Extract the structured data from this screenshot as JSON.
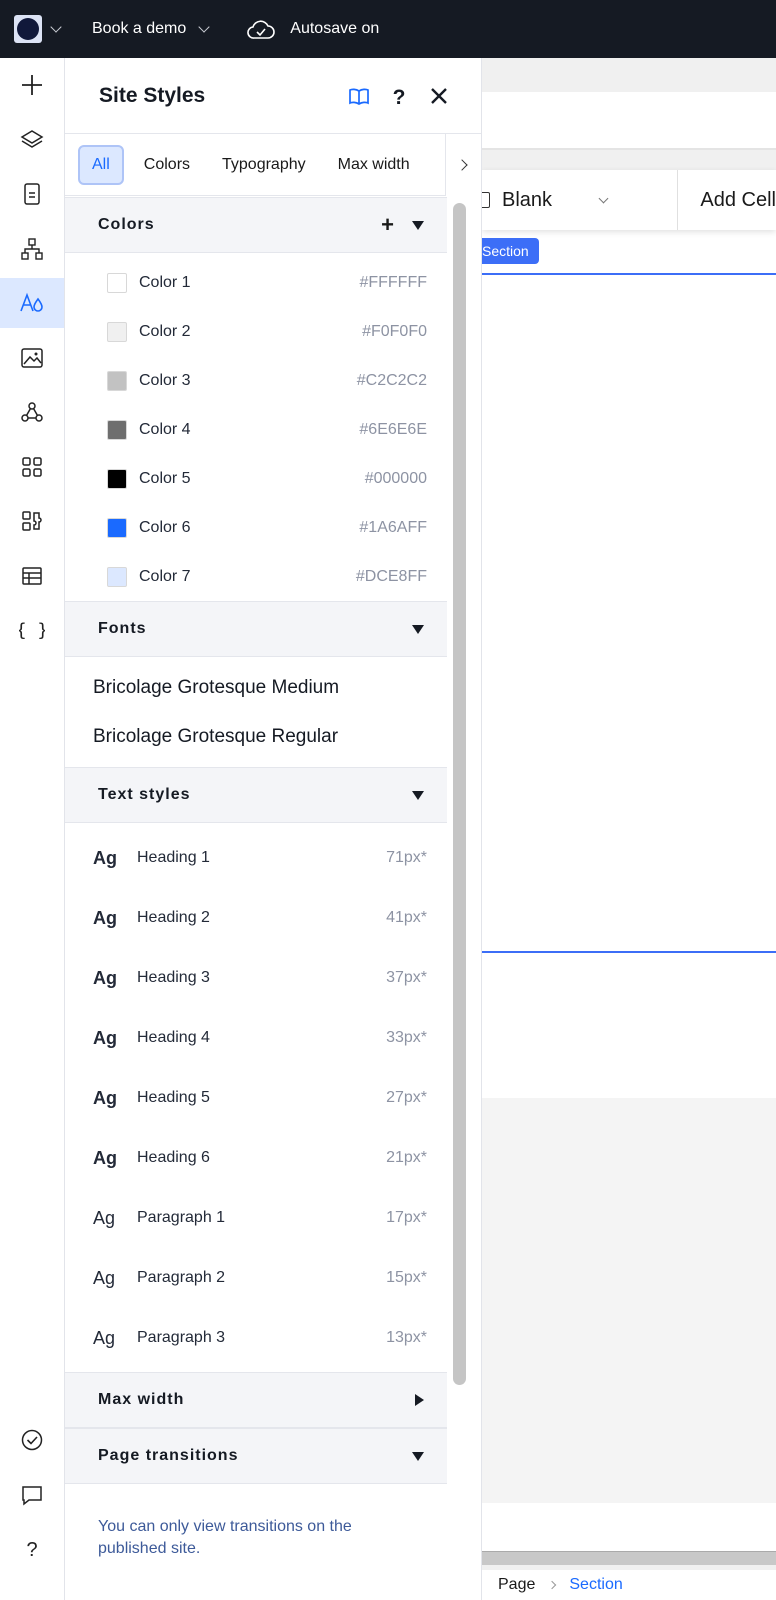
{
  "topbar": {
    "menu": "Book a demo",
    "autosave": "Autosave on"
  },
  "rail": {
    "items": [
      "add-icon",
      "layers-icon",
      "pages-icon",
      "sitemap-icon",
      "site-styles-icon",
      "media-icon",
      "integrations-icon",
      "apps-icon",
      "puzzle-icon",
      "cms-table-icon",
      "code-icon"
    ],
    "active": "site-styles-icon",
    "bottom": [
      "checklist-icon",
      "chat-icon",
      "help-icon"
    ]
  },
  "panel": {
    "title": "Site Styles",
    "tabs": [
      "All",
      "Colors",
      "Typography",
      "Max width"
    ],
    "active_tab": "All"
  },
  "colors": {
    "title": "Colors",
    "items": [
      {
        "name": "Color 1",
        "hex": "#FFFFFF"
      },
      {
        "name": "Color 2",
        "hex": "#F0F0F0"
      },
      {
        "name": "Color 3",
        "hex": "#C2C2C2"
      },
      {
        "name": "Color 4",
        "hex": "#6E6E6E"
      },
      {
        "name": "Color 5",
        "hex": "#000000"
      },
      {
        "name": "Color 6",
        "hex": "#1A6AFF"
      },
      {
        "name": "Color 7",
        "hex": "#DCE8FF"
      }
    ]
  },
  "fonts": {
    "title": "Fonts",
    "items": [
      "Bricolage Grotesque Medium",
      "Bricolage Grotesque Regular"
    ]
  },
  "text_styles": {
    "title": "Text styles",
    "items": [
      {
        "ag": "Ag",
        "name": "Heading 1",
        "size": "71px*"
      },
      {
        "ag": "Ag",
        "name": "Heading 2",
        "size": "41px*"
      },
      {
        "ag": "Ag",
        "name": "Heading 3",
        "size": "37px*"
      },
      {
        "ag": "Ag",
        "name": "Heading 4",
        "size": "33px*"
      },
      {
        "ag": "Ag",
        "name": "Heading 5",
        "size": "27px*"
      },
      {
        "ag": "Ag",
        "name": "Heading 6",
        "size": "21px*"
      },
      {
        "ag": "Ag",
        "name": "Paragraph 1",
        "size": "17px*"
      },
      {
        "ag": "Ag",
        "name": "Paragraph 2",
        "size": "15px*"
      },
      {
        "ag": "Ag",
        "name": "Paragraph 3",
        "size": "13px*"
      }
    ]
  },
  "max_width": {
    "title": "Max width"
  },
  "page_transitions": {
    "title": "Page transitions",
    "note": "You can only view transitions on the published site."
  },
  "canvas": {
    "layout_select": "Blank",
    "add_cell": "Add Cell",
    "section_tag": "Section"
  },
  "breadcrumb": {
    "page": "Page",
    "current": "Section"
  }
}
